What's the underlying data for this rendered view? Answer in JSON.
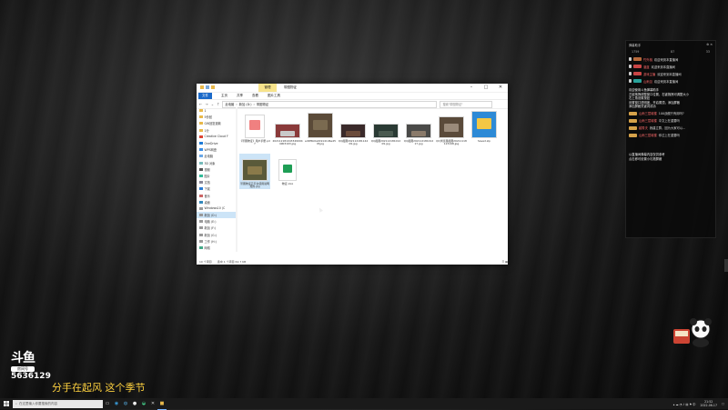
{
  "explorer": {
    "manage_tab": "管理",
    "title": "带图物证",
    "ribbon_tabs": [
      "文件",
      "主页",
      "共享",
      "查看",
      "图片工具"
    ],
    "address": {
      "crumbs": [
        "此电脑",
        "新加 (D:)",
        "带图物证"
      ],
      "search_placeholder": "搜索\"带图物证\""
    },
    "sidebar": [
      {
        "label": "1",
        "icon": "folder-icon"
      },
      {
        "label": "5份回",
        "icon": "folder-icon"
      },
      {
        "label": "GW回复退款",
        "icon": "folder-icon"
      },
      {
        "label": "1分",
        "icon": "folder-icon"
      },
      {
        "label": "Creative Cloud F",
        "icon": "cloud-icon"
      },
      {
        "label": "OneDrive",
        "icon": "onedrive-icon"
      },
      {
        "label": "WPS网盘",
        "icon": "wps-icon"
      },
      {
        "label": "此电脑",
        "icon": "computer-icon"
      },
      {
        "label": "3D 对象",
        "icon": "cube-icon"
      },
      {
        "label": "视频",
        "icon": "video-icon"
      },
      {
        "label": "图片",
        "icon": "picture-icon"
      },
      {
        "label": "文档",
        "icon": "document-icon"
      },
      {
        "label": "下载",
        "icon": "download-icon"
      },
      {
        "label": "音乐",
        "icon": "music-icon"
      },
      {
        "label": "桌面",
        "icon": "desktop-icon"
      },
      {
        "label": "Windows10 (C",
        "icon": "drive-icon"
      },
      {
        "label": "新加 (D:)",
        "icon": "drive-icon",
        "selected": true
      },
      {
        "label": "电脑 (E:)",
        "icon": "drive-icon"
      },
      {
        "label": "新加 (F:)",
        "icon": "drive-icon"
      },
      {
        "label": "新加 (G:)",
        "icon": "drive-icon"
      },
      {
        "label": "工作 (H:)",
        "icon": "drive-icon"
      },
      {
        "label": "网络",
        "icon": "network-icon"
      }
    ],
    "files": [
      {
        "name": "《带图物证》用户手册.pdf",
        "kind": "pdf"
      },
      {
        "name": "2021121810433490944903193.jpg",
        "kind": "img1"
      },
      {
        "name": "ed0f6b0a919141d6e459f.jpg",
        "kind": "img2"
      },
      {
        "name": "QQ截图20211218114409.jpg",
        "kind": "img3"
      },
      {
        "name": "QQ截图20211218101209.jpg",
        "kind": "img4"
      },
      {
        "name": "QQ截图20211218101217.jpg",
        "kind": "img5"
      },
      {
        "name": "QQ浏览器截图20211118123198.jpg",
        "kind": "img6"
      },
      {
        "name": "Saved.zip",
        "kind": "zip"
      },
      {
        "name": "带图物证云平台使用说明真的.jpg",
        "kind": "img7",
        "selected": true
      },
      {
        "name": "物证.xlsx",
        "kind": "xlsx"
      }
    ],
    "status": {
      "count": "10 个项目",
      "selected": "选中 1 个项目 62.7 KB"
    }
  },
  "chat": {
    "header_title": "弹幕助手",
    "stats": [
      "1759",
      "87",
      "33"
    ],
    "messages": [
      {
        "user": "竹外桃",
        "text": "欢迎来到本直播间",
        "badge_color": "#b86a3c"
      },
      {
        "user": "湛蓝",
        "text": "欢迎来到本直播间",
        "badge_color": "#c94545"
      },
      {
        "user": "游戏主播",
        "text": "欢迎来到本直播间",
        "badge_color": "#c94545"
      },
      {
        "user": "山雨见",
        "text": "欢迎来到本直播间",
        "badge_color": "#29a39b"
      }
    ],
    "system_lines": [
      "欢迎使用斗鱼弹幕助手",
      "左键拖拽调整窗口位置，右键拖拽可调整大小",
      "右上角设置按钮",
      "设置窗口透明度，开启置顶，添加屏蔽",
      "添加屏蔽关键词成功"
    ],
    "gift_lines": [
      {
        "user": "山雨三层城楼",
        "text": "100战舰只有用吗?"
      },
      {
        "user": "山雨三层城楼",
        "text": "中文上在重要吗"
      },
      {
        "user": "越秀夫",
        "text": "我建立群，因为大家可以..."
      },
      {
        "user": "山雨三层城楼",
        "text": "你过上在重要吗"
      }
    ],
    "footer_lines": [
      "以直播间弹幕内容仅供参考",
      "点击即可设置小礼物屏蔽"
    ]
  },
  "overlay": {
    "logo_big": "斗鱼",
    "room_label": "房间号",
    "room_number": "5636129",
    "marquee": "分手在起风 这个季节"
  },
  "taskbar": {
    "search_placeholder": "在这里输入你要搜索的内容",
    "time": "21:52",
    "date": "2022-06-17"
  }
}
